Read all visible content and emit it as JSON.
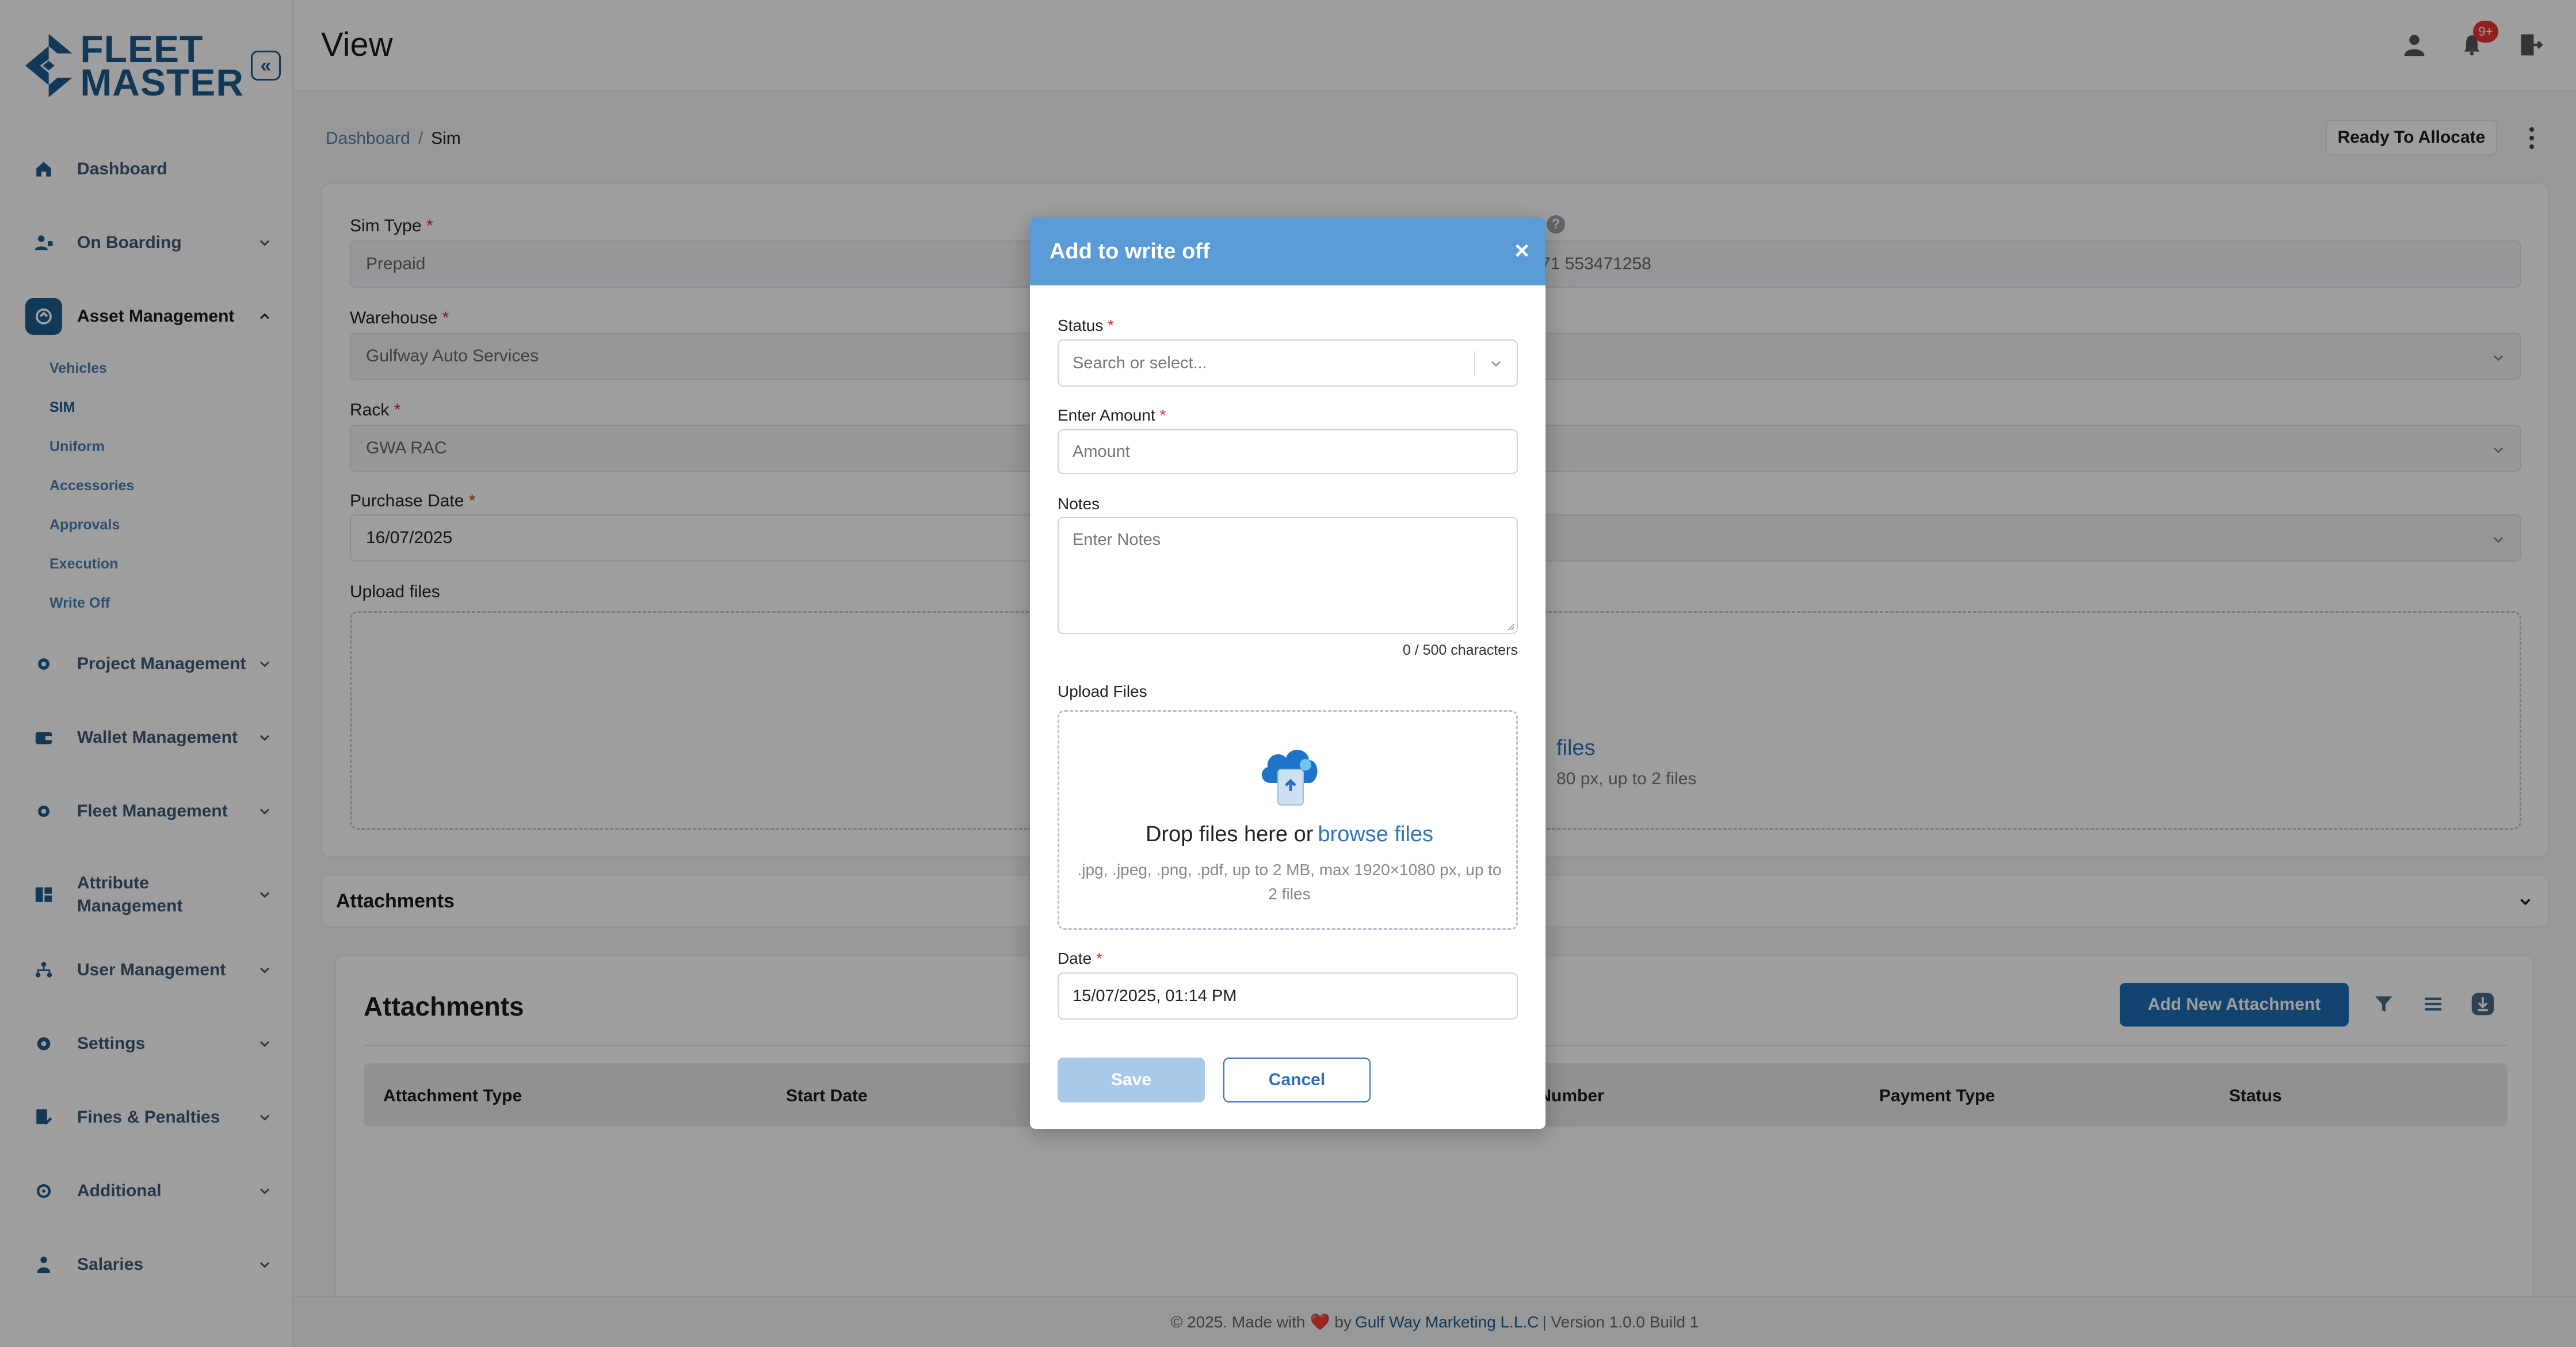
{
  "brand": {
    "line1": "FLEET",
    "line2": "MASTER"
  },
  "header": {
    "title": "View",
    "notification_count": "9+"
  },
  "sidebar": {
    "items": [
      {
        "label": "Dashboard"
      },
      {
        "label": "On Boarding"
      },
      {
        "label": "Asset Management"
      },
      {
        "label": "Project Management"
      },
      {
        "label": "Wallet Management"
      },
      {
        "label": "Fleet Management"
      },
      {
        "label": "Attribute Management"
      },
      {
        "label": "User Management"
      },
      {
        "label": "Settings"
      },
      {
        "label": "Fines & Penalties"
      },
      {
        "label": "Additional"
      },
      {
        "label": "Salaries"
      }
    ],
    "sub_items": [
      "Vehicles",
      "SIM",
      "Uniform",
      "Accessories",
      "Approvals",
      "Execution",
      "Write Off"
    ]
  },
  "breadcrumb": {
    "root": "Dashboard",
    "separator": "/",
    "current": "Sim"
  },
  "actions": {
    "status_button": "Ready To Allocate"
  },
  "form": {
    "sim_type_label": "Sim Type",
    "sim_type_value": "Prepaid",
    "number_value": "71 553471258",
    "warehouse_label": "Warehouse",
    "warehouse_value": "Gulfway Auto Services",
    "rack_label": "Rack",
    "rack_value": "GWA RAC",
    "purchase_date_label": "Purchase Date",
    "purchase_date_value": "16/07/2025",
    "upload_label": "Upload files",
    "upload_link_fragment": "files",
    "upload_hint_fragment": "80 px, up to 2 files",
    "required_mark": "*"
  },
  "attachments": {
    "accordion_title": "Attachments",
    "card_title": "Attachments",
    "add_button": "Add New Attachment",
    "columns": [
      "Attachment Type",
      "Start Date",
      "t Number",
      "Payment Type",
      "Status"
    ]
  },
  "footer": {
    "prefix": "© 2025. Made with",
    "heart": "❤️",
    "by": "by",
    "company": "Gulf Way Marketing L.L.C",
    "version": "| Version 1.0.0 Build 1"
  },
  "modal": {
    "title": "Add to write off",
    "close": "×",
    "status_label": "Status",
    "status_placeholder": "Search or select...",
    "amount_label": "Enter Amount",
    "amount_placeholder": "Amount",
    "notes_label": "Notes",
    "notes_placeholder": "Enter Notes",
    "char_count": "0 / 500 characters",
    "upload_label": "Upload Files",
    "drop_text": "Drop files here or",
    "browse_text": "browse files",
    "drop_hint": ".jpg, .jpeg, .png, .pdf, up to 2 MB, max 1920×1080 px, up to 2 files",
    "date_label": "Date",
    "date_value": "15/07/2025, 01:14 PM",
    "save_button": "Save",
    "cancel_button": "Cancel",
    "required_mark": "*"
  },
  "colors": {
    "brand": "#1d5b8e",
    "modal_header": "#5b9bd6",
    "primary": "#1f6db4",
    "danger": "#dd3333"
  }
}
